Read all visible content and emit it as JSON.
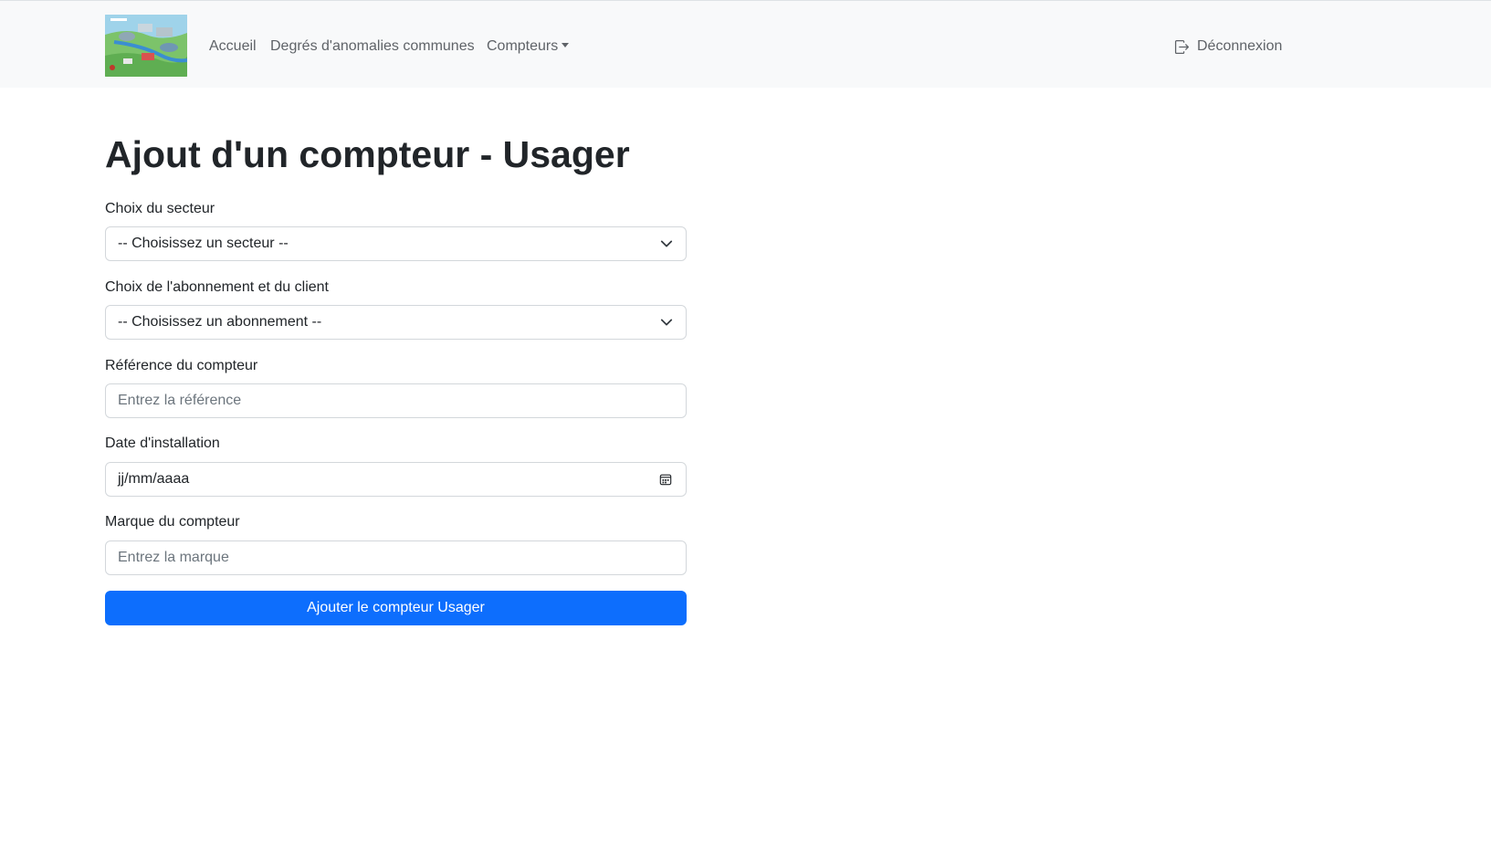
{
  "navbar": {
    "logo_alt": "logo",
    "links": [
      {
        "label": "Accueil"
      },
      {
        "label": "Degrés d'anomalies communes"
      },
      {
        "label": "Compteurs"
      }
    ],
    "logout_label": "Déconnexion",
    "logout_icon": "logout-icon"
  },
  "page": {
    "title": "Ajout d'un compteur - Usager"
  },
  "form": {
    "secteur": {
      "label": "Choix du secteur",
      "selected": "-- Choisissez un secteur --"
    },
    "abonnement": {
      "label": "Choix de l'abonnement et du client",
      "selected": "-- Choisissez un abonnement --"
    },
    "reference": {
      "label": "Référence du compteur",
      "placeholder": "Entrez la référence"
    },
    "date": {
      "label": "Date d'installation",
      "value": "jj/mm/aaaa"
    },
    "marque": {
      "label": "Marque du compteur",
      "placeholder": "Entrez la marque"
    },
    "submit_label": "Ajouter le compteur Usager"
  },
  "colors": {
    "navbar_bg": "#f8f9fa",
    "primary": "#0d6efd",
    "text": "#212529",
    "muted": "#6c757d"
  }
}
